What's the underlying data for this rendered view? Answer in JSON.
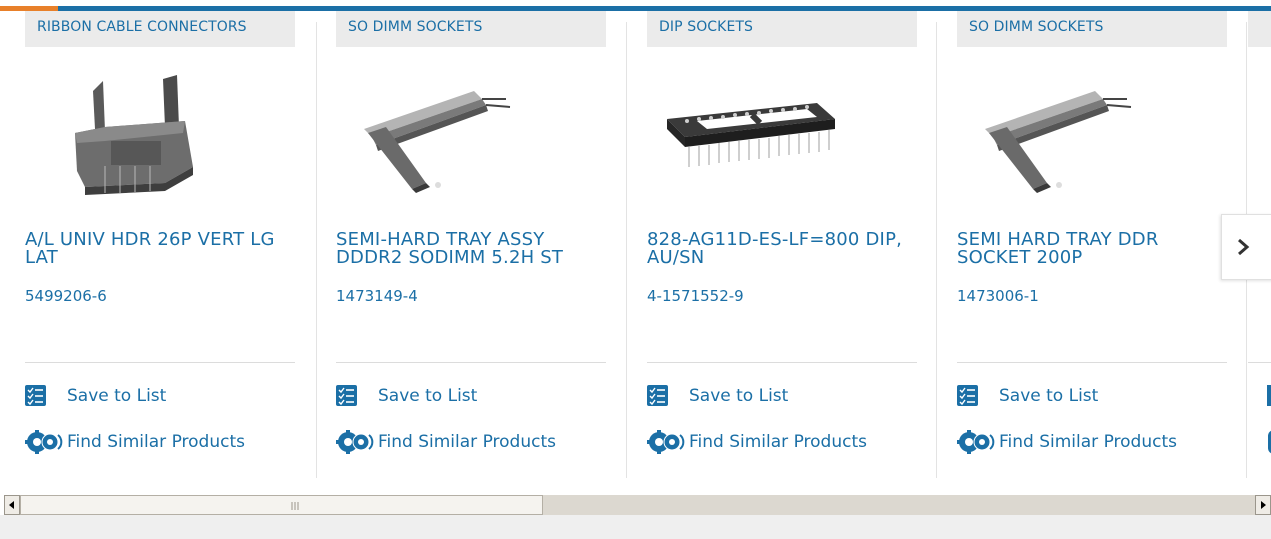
{
  "products": [
    {
      "category": "RIBBON CABLE CONNECTORS",
      "title": "A/L UNIV HDR 26P VERT LG LAT",
      "part_number": "5499206-6",
      "save_label": "Save to List",
      "similar_label": "Find Similar Products"
    },
    {
      "category": "SO DIMM SOCKETS",
      "title": "SEMI-HARD TRAY ASSY DDDR2 SODIMM 5.2H ST",
      "part_number": "1473149-4",
      "save_label": "Save to List",
      "similar_label": "Find Similar Products"
    },
    {
      "category": "DIP SOCKETS",
      "title": "828-AG11D-ES-LF=800 DIP, AU/SN",
      "part_number": "4-1571552-9",
      "save_label": "Save to List",
      "similar_label": "Find Similar Products"
    },
    {
      "category": "SO DIMM SOCKETS",
      "title": "SEMI HARD TRAY DDR SOCKET 200P",
      "part_number": "1473006-1",
      "save_label": "Save to List",
      "similar_label": "Find Similar Products"
    }
  ],
  "colors": {
    "accent_blue": "#1b6fa6",
    "accent_orange": "#e8802a",
    "category_bg": "#ebebeb"
  },
  "icons": {
    "save": "list-check-icon",
    "similar": "gears-icon",
    "next": "chevron-right-icon"
  }
}
